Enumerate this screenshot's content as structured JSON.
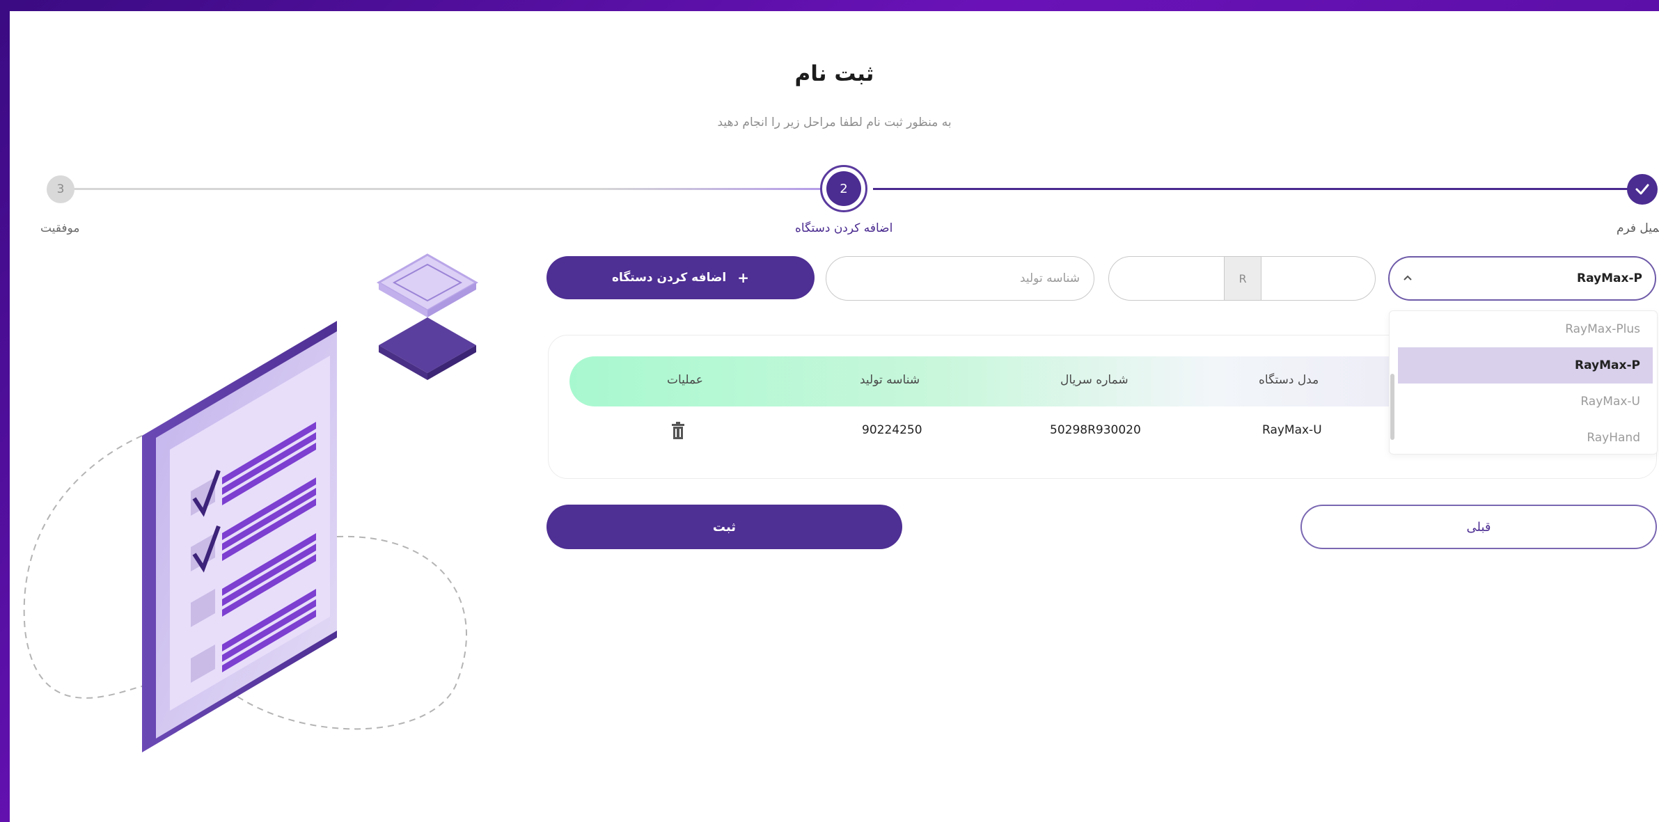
{
  "header": {
    "title": "ثبت نام",
    "subtitle": "به منظور ثبت نام لطفا مراحل زیر را انجام دهید"
  },
  "stepper": {
    "steps": [
      {
        "number": "",
        "label": "تکمیل فرم",
        "state": "done"
      },
      {
        "number": "2",
        "label": "اضافه کردن دستگاه",
        "state": "active"
      },
      {
        "number": "3",
        "label": "موفقیت",
        "state": "pending"
      }
    ]
  },
  "form": {
    "model_select": {
      "value": "RayMax-P"
    },
    "serial": {
      "prefix": "R",
      "left_value": "",
      "right_value": ""
    },
    "production_id": {
      "placeholder": "شناسه تولید",
      "value": ""
    },
    "add_button": {
      "label": "اضافه کردن دستگاه",
      "icon": "plus-icon"
    }
  },
  "dropdown": {
    "options": [
      "RayMax-Plus",
      "RayMax-P",
      "RayMax-U",
      "RayHand"
    ],
    "selected": "RayMax-P"
  },
  "table": {
    "columns": [
      "مدل دستگاه",
      "شماره سریال",
      "شناسه تولید",
      "عملیات"
    ],
    "rows": [
      {
        "model": "RayMax-U",
        "serial": "50298R930020",
        "production_id": "90224250",
        "action_icon": "trash-icon"
      }
    ]
  },
  "actions": {
    "submit_label": "ثبت",
    "previous_label": "قبلی"
  },
  "colors": {
    "primary": "#4e2f93",
    "frame": "#5d0aa8",
    "table_header_start": "#a8f8cf",
    "dropdown_selected": "#d9d0ec"
  }
}
